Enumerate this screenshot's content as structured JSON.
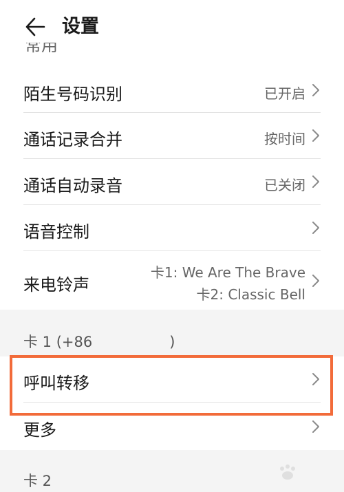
{
  "header": {
    "title": "设置",
    "back_icon": "back-arrow-icon"
  },
  "scroll_partial": "常用",
  "rows": [
    {
      "label": "陌生号码识别",
      "value": "已开启"
    },
    {
      "label": "通话记录合并",
      "value": "按时间"
    },
    {
      "label": "通话自动录音",
      "value": "已关闭"
    },
    {
      "label": "语音控制",
      "value": ""
    },
    {
      "label": "来电铃声",
      "value_line1": "卡1: We Are The Brave",
      "value_line2": "卡2: Classic Bell"
    }
  ],
  "card1": {
    "label_prefix": "卡 1 (+86",
    "label_suffix": ")",
    "rows": [
      {
        "label": "呼叫转移"
      },
      {
        "label": "更多"
      }
    ]
  },
  "card2": {
    "label": "卡 2"
  },
  "colors": {
    "highlight": "#f26b3a",
    "background": "#f4f4f4",
    "surface": "#ffffff"
  }
}
